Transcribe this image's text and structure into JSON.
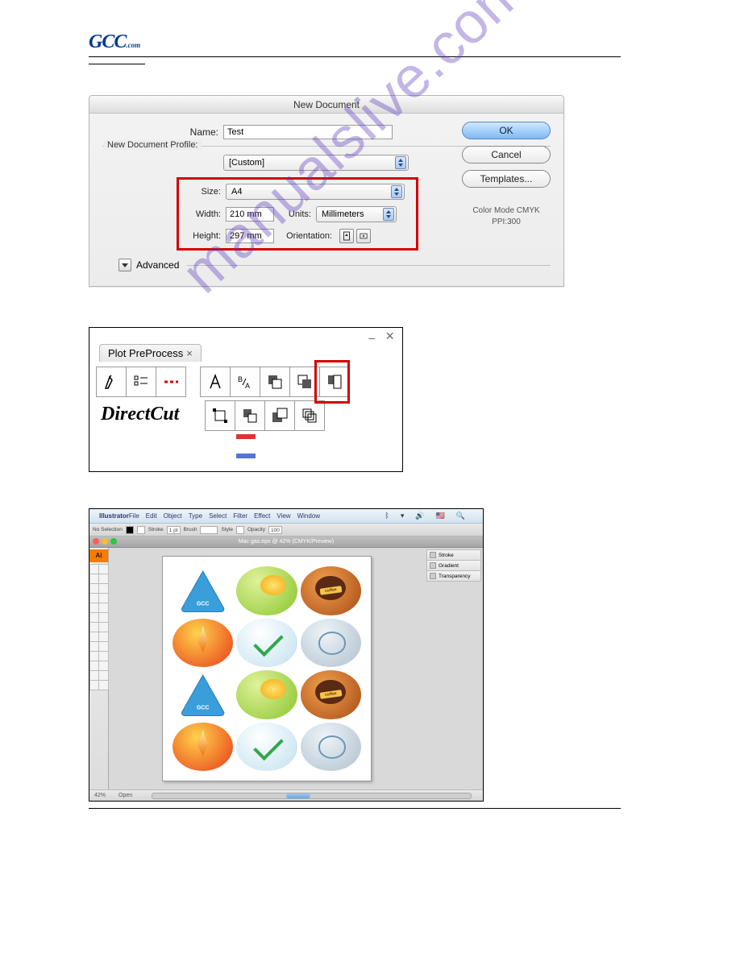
{
  "brand": "GCC",
  "brand_tail": ".com",
  "watermark": "manualslive.com",
  "dialog1": {
    "title": "New Document",
    "name_label": "Name:",
    "name_value": "Test",
    "profile_label": "New Document Profile:",
    "profile_value": "[Custom]",
    "size_label": "Size:",
    "size_value": "A4",
    "width_label": "Width:",
    "width_value": "210 mm",
    "units_label": "Units:",
    "units_value": "Millimeters",
    "height_label": "Height:",
    "height_value": "297 mm",
    "orientation_label": "Orientation:",
    "advanced_label": "Advanced",
    "ok": "OK",
    "cancel": "Cancel",
    "templates": "Templates...",
    "color_mode_line1": "Color Mode CMYK",
    "color_mode_line2": "PPI:300"
  },
  "panel2": {
    "tab": "Plot PreProcess",
    "title": "DirectCut",
    "icons_row1": [
      "pen-icon",
      "list-icon",
      "dash-icon",
      "outline-a-icon",
      "sort-ba-icon",
      "overlap-1-icon",
      "overlap-2-icon",
      "overlap-3-icon"
    ],
    "icons_row2": [
      "corners-icon",
      "overlap-shift-icon",
      "overlap-twist-icon",
      "stack-icon"
    ],
    "highlight_index": 6
  },
  "shot3": {
    "app": "Illustrator",
    "menus": [
      "File",
      "Edit",
      "Object",
      "Type",
      "Select",
      "Filter",
      "Effect",
      "View",
      "Window"
    ],
    "ctrl_noselection": "No Selection",
    "ctrl_labels": {
      "stroke": "Stroke",
      "brush": "Brush",
      "style": "Style",
      "opacity": "Opacity"
    },
    "ctrl_stroke_val": "1 pt",
    "ctrl_opacity_val": "100",
    "doc_title": "Mac gas.eps @ 42% (CMYK/Preview)",
    "panels": [
      "Stroke",
      "Gradient",
      "Transparency"
    ],
    "zoom": "42%",
    "status": "Open",
    "flag": "🇺🇸"
  }
}
